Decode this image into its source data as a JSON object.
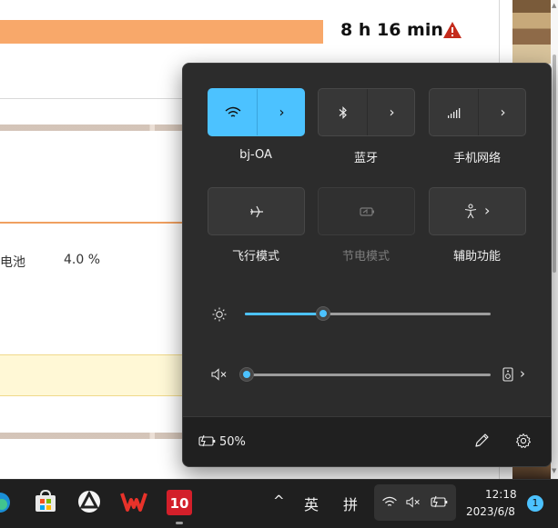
{
  "background_window": {
    "duration": "8 h 16 min",
    "battery_label": "电池",
    "battery_value": "4.0 %"
  },
  "quick_settings": {
    "tiles": [
      {
        "label": "bj-OA",
        "icon": "wifi-icon",
        "state": "on"
      },
      {
        "label": "蓝牙",
        "icon": "bluetooth-icon",
        "state": "off"
      },
      {
        "label": "手机网络",
        "icon": "cellular-icon",
        "state": "off"
      },
      {
        "label": "飞行模式",
        "icon": "airplane-icon",
        "state": "off"
      },
      {
        "label": "节电模式",
        "icon": "battery-saver-icon",
        "state": "disabled"
      },
      {
        "label": "辅助功能",
        "icon": "accessibility-icon",
        "state": "off"
      }
    ],
    "brightness_level": 0.32,
    "volume_level": 0.0,
    "battery_text": "50%"
  },
  "taskbar": {
    "input_lang": "英",
    "input_mode": "拼",
    "time": "12:18",
    "date": "2023/6/8",
    "notification_count": "1"
  },
  "colors": {
    "accent": "#4cc2ff",
    "panel_bg": "#2c2c2c",
    "warning": "#c42b1c",
    "bar_orange": "#f8a86a"
  }
}
